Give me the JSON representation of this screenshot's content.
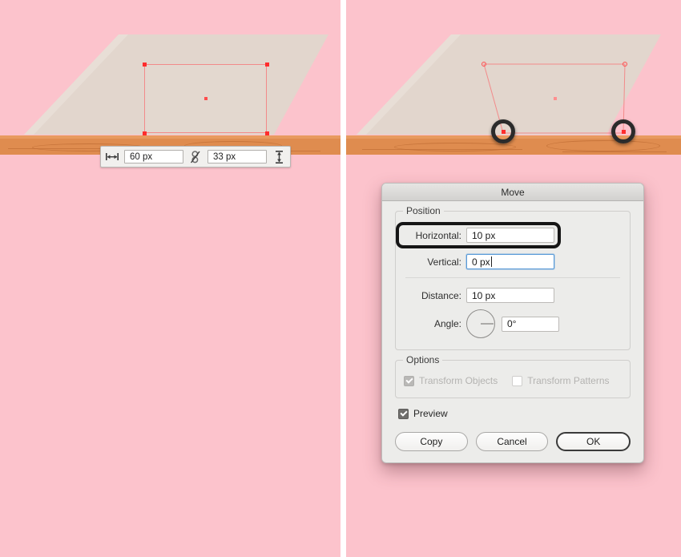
{
  "canvas": {
    "background_color": "#fcc3cc",
    "shape_color": "#e2d6cd",
    "shape_shadow_color": "#e8ded6",
    "plank_color": "#df8c4f",
    "plank_highlight_color": "#e89a5f",
    "selection_color": "#f28a8a",
    "anchor_color": "#ff2d2d"
  },
  "left_panel": {
    "name": "before-state",
    "transform_toolbar": {
      "width_icon": "width-arrows-icon",
      "width_value": "60 px",
      "link_icon": "broken-chain-link-icon",
      "height_value": "33 px",
      "height_icon": "height-arrows-icon"
    },
    "selection": {
      "center_dot": "center-anchor-point",
      "anchors": [
        "top-left",
        "top-right",
        "bottom-left",
        "bottom-right"
      ]
    }
  },
  "right_panel": {
    "name": "after-state",
    "markers": [
      "bottom-left-ring-marker",
      "bottom-right-ring-marker"
    ],
    "selection": {
      "center_dot": "center-anchor-point",
      "anchors": [
        "top-left",
        "top-right",
        "bottom-left",
        "bottom-right"
      ]
    }
  },
  "dialog": {
    "title": "Move",
    "position_group": {
      "label": "Position",
      "horizontal": {
        "label": "Horizontal:",
        "value": "10 px",
        "highlighted": true
      },
      "vertical": {
        "label": "Vertical:",
        "value": "0 px",
        "focused": true
      },
      "distance": {
        "label": "Distance:",
        "value": "10 px"
      },
      "angle": {
        "label": "Angle:",
        "value": "0°",
        "dial_icon": "angle-dial-icon"
      }
    },
    "options_group": {
      "label": "Options",
      "transform_objects": {
        "label": "Transform Objects",
        "checked": true,
        "disabled": true
      },
      "transform_patterns": {
        "label": "Transform Patterns",
        "checked": false,
        "disabled": true
      }
    },
    "preview": {
      "label": "Preview",
      "checked": true
    },
    "buttons": {
      "copy": "Copy",
      "cancel": "Cancel",
      "ok": "OK"
    }
  }
}
